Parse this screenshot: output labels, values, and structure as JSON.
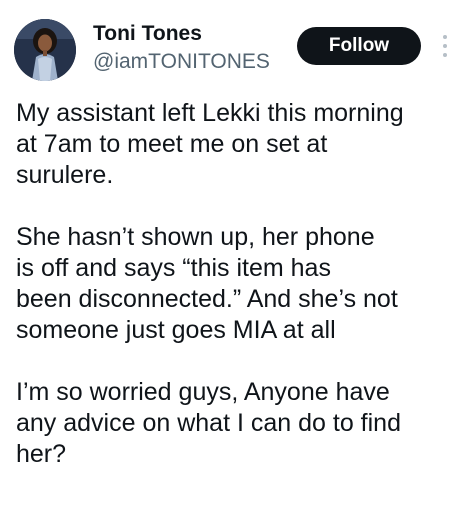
{
  "author": {
    "display_name": "Toni Tones",
    "handle": "@iamTONITONES",
    "avatar_icon": "profile-photo"
  },
  "actions": {
    "follow_label": "Follow",
    "more_icon": "vertical-ellipsis-icon"
  },
  "tweet": {
    "paragraphs": [
      [
        "My assistant left Lekki this morning",
        "at 7am to meet me on set at",
        "surulere."
      ],
      [
        "She hasn’t shown up, her phone",
        "is off and says “this item has",
        "been disconnected.” And she’s not",
        "someone just goes MIA at all"
      ],
      [
        "I’m so worried guys, Anyone have",
        "any advice on what I can do to find",
        "her?"
      ]
    ]
  },
  "colors": {
    "text_primary": "#0f1419",
    "text_secondary": "#536471",
    "button_bg": "#0f1419",
    "button_text": "#ffffff",
    "dots": "#b6bfc7"
  }
}
